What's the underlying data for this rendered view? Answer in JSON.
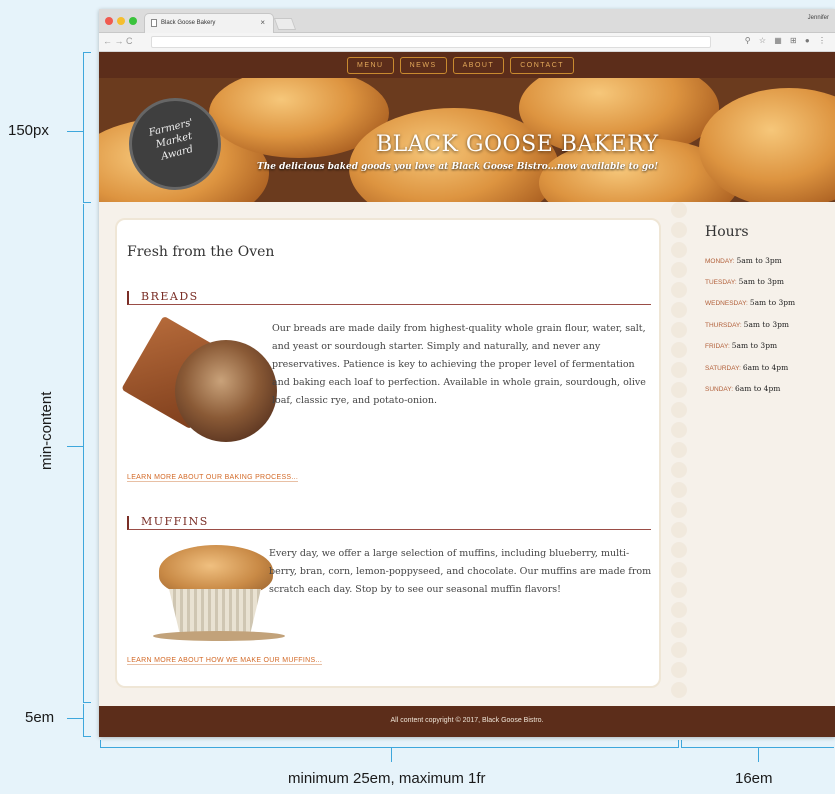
{
  "browser": {
    "tab_title": "Black Goose Bakery",
    "tab_close": "×",
    "profile": "Jennifer",
    "nav_icons": "← → C",
    "ext_icons": "⚲ ☆ ▦ ⊞ ● ⋮",
    "traffic_colors": [
      "#f05a4f",
      "#f5be2f",
      "#3ac33c"
    ]
  },
  "nav": {
    "items": [
      "MENU",
      "NEWS",
      "ABOUT",
      "CONTACT"
    ]
  },
  "header": {
    "award_lines": [
      "Farmers'",
      "Market",
      "Award"
    ],
    "title": "BLACK GOOSE BAKERY",
    "tagline": "The delicious baked goods you love at Black Goose Bistro...now available to go!"
  },
  "main": {
    "heading": "Fresh from the Oven",
    "breads": {
      "heading": "BREADS",
      "text": "Our breads are made daily from highest-quality whole grain flour, water, salt, and yeast or sourdough starter. Simply and naturally, and never any preservatives. Patience is key to achieving the proper level of fermentation and baking each loaf to perfection. Available in whole grain, sourdough, olive loaf, classic rye, and potato-onion.",
      "link": "LEARN MORE ABOUT OUR BAKING PROCESS..."
    },
    "muffins": {
      "heading": "MUFFINS",
      "text": "Every day, we offer a large selection of muffins, including blueberry, multi-berry, bran, corn, lemon-poppyseed, and chocolate. Our muffins are made from scratch each day. Stop by to see our seasonal muffin flavors!",
      "link": "LEARN MORE ABOUT HOW WE MAKE OUR MUFFINS..."
    }
  },
  "sidebar": {
    "heading": "Hours",
    "hours": [
      {
        "day": "MONDAY:",
        "time": "5am to 3pm"
      },
      {
        "day": "TUESDAY:",
        "time": "5am to 3pm"
      },
      {
        "day": "WEDNESDAY:",
        "time": "5am to 3pm"
      },
      {
        "day": "THURSDAY:",
        "time": "5am to 3pm"
      },
      {
        "day": "FRIDAY:",
        "time": "5am to 3pm"
      },
      {
        "day": "SATURDAY:",
        "time": "6am to 4pm"
      },
      {
        "day": "SUNDAY:",
        "time": "6am to 4pm"
      }
    ]
  },
  "footer": {
    "text": "All content copyright © 2017, Black Goose Bistro."
  },
  "annotations": {
    "row_header": "150px",
    "row_main": "min-content",
    "row_footer": "5em",
    "col_main": "minimum 25em, maximum 1fr",
    "col_sidebar": "16em"
  },
  "colors": {
    "brand_brown": "#5c2d1a",
    "accent_orange": "#d36a28",
    "section_red": "#7a2e26",
    "guide_blue": "#3ea7dc"
  }
}
